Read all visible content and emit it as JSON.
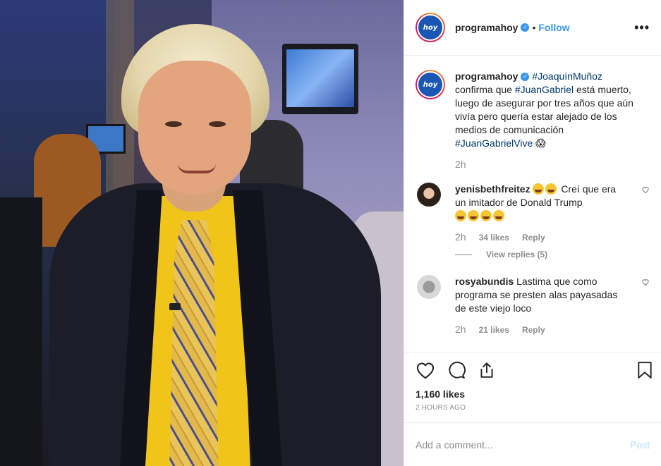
{
  "post": {
    "username": "programahoy",
    "avatar_text": "hoy",
    "follow_label": "Follow",
    "dot": "•",
    "more_label": "•••"
  },
  "caption": {
    "username": "programahoy",
    "tag1": "#JoaquínMuñoz",
    "text1": " confirma que ",
    "tag2": "#JuanGabriel",
    "text2": " está muerto, luego de asegurar por tres años que aún vivía pero quería estar alejado de los medios de comunicación ",
    "tag3": "#JuanGabrielVive",
    "emoji": "😱",
    "time": "2h"
  },
  "comments": [
    {
      "username": "yenisbethfreitez",
      "text": "Creí que era un imitador de Donald Trump",
      "time": "2h",
      "likes": "34 likes",
      "reply": "Reply",
      "view_replies": "View replies (5)"
    },
    {
      "username": "rosyabundis",
      "text": "Lastima que como programa se presten alas payasadas de este viejo loco",
      "time": "2h",
      "likes": "21 likes",
      "reply": "Reply"
    }
  ],
  "footer": {
    "likes": "1,160 likes",
    "ago": "2 HOURS AGO",
    "comment_placeholder": "Add a comment...",
    "post_label": "Post"
  },
  "icons": {
    "heart": "heart-icon",
    "comment": "comment-icon",
    "share": "share-icon",
    "bookmark": "bookmark-icon",
    "verified": "verified-badge-icon"
  },
  "colors": {
    "link": "#3897f0",
    "hashtag": "#00376b",
    "muted": "#8e8e8e",
    "text": "#262626"
  }
}
